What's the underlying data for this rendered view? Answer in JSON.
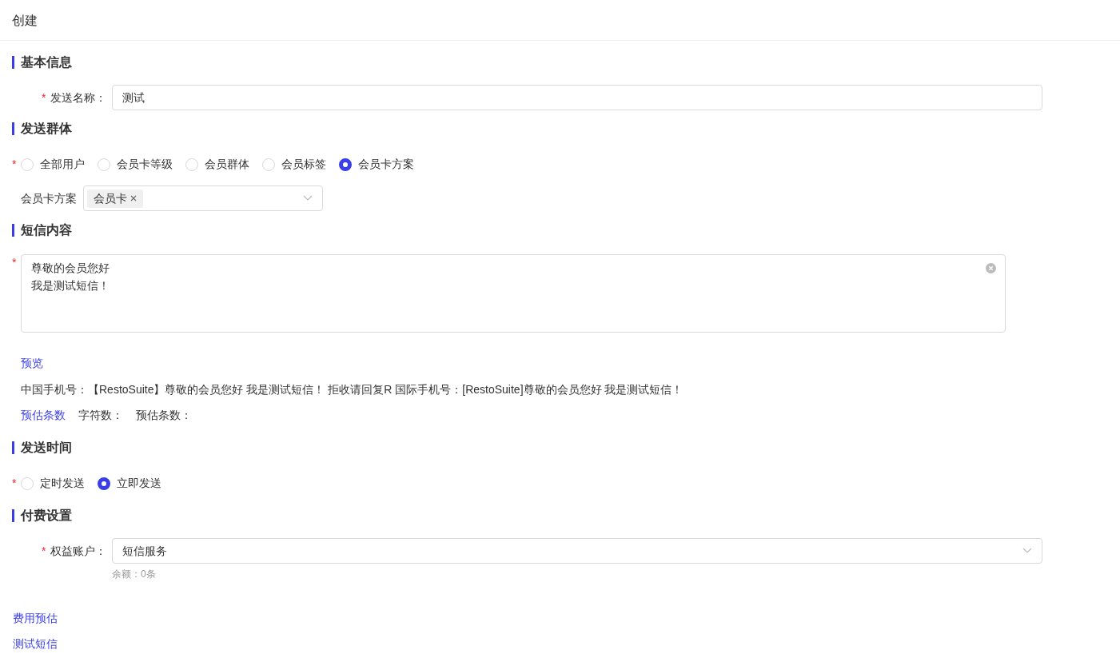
{
  "header": {
    "title": "创建"
  },
  "sections": [
    {
      "kind": "name",
      "title": "基本信息",
      "field": {
        "required_mark": "*",
        "label": "发送名称：",
        "value": "测试"
      }
    },
    {
      "kind": "audience",
      "title": "发送群体",
      "required_mark": "*",
      "options": [
        {
          "label": "全部用户",
          "selected": false
        },
        {
          "label": "会员卡等级",
          "selected": false
        },
        {
          "label": "会员群体",
          "selected": false
        },
        {
          "label": "会员标签",
          "selected": false
        },
        {
          "label": "会员卡方案",
          "selected": true
        }
      ],
      "select": {
        "label": "会员卡方案",
        "tags": [
          "会员卡"
        ]
      }
    },
    {
      "kind": "content",
      "title": "短信内容",
      "required_mark": "*",
      "lines": [
        "尊敬的会员您好",
        "我是测试短信！"
      ],
      "preview_link": "预览",
      "preview_text": "中国手机号：【RestoSuite】尊敬的会员您好 我是测试短信！ 拒收请回复R 国际手机号：[RestoSuite]尊敬的会员您好 我是测试短信！",
      "estimate_link": "预估条数",
      "char_count_label": "字符数：",
      "estimate_label": "预估条数："
    },
    {
      "kind": "time",
      "title": "发送时间",
      "required_mark": "*",
      "options": [
        {
          "label": "定时发送",
          "selected": false
        },
        {
          "label": "立即发送",
          "selected": true
        }
      ]
    },
    {
      "kind": "payment",
      "title": "付费设置",
      "field": {
        "required_mark": "*",
        "label": "权益账户：",
        "value": "短信服务",
        "hint": "余额：0条"
      }
    }
  ],
  "footer_links": [
    "费用预估",
    "测试短信"
  ]
}
